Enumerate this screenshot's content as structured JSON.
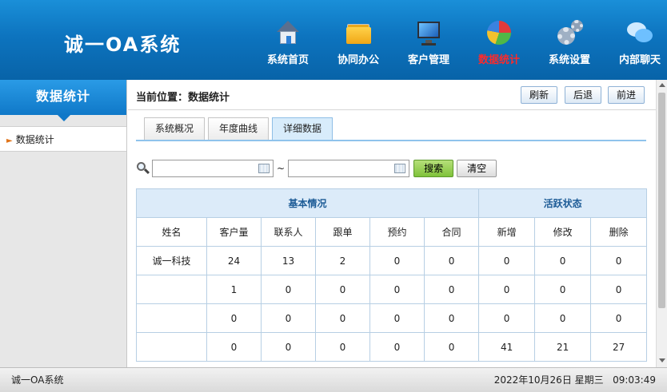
{
  "app": {
    "title": "诚一OA系统"
  },
  "nav": [
    {
      "label": "系统首页",
      "icon": "home-icon"
    },
    {
      "label": "协同办公",
      "icon": "folder-icon"
    },
    {
      "label": "客户管理",
      "icon": "monitor-icon"
    },
    {
      "label": "数据统计",
      "icon": "pie-chart-icon",
      "active": true
    },
    {
      "label": "系统设置",
      "icon": "gear-icon"
    },
    {
      "label": "内部聊天",
      "icon": "chat-icon"
    }
  ],
  "sidebar": {
    "title": "数据统计",
    "items": [
      {
        "label": "数据统计"
      }
    ]
  },
  "breadcrumb": {
    "prefix": "当前位置：",
    "current": "数据统计"
  },
  "toolbar": {
    "refresh": "刷新",
    "back": "后退",
    "forward": "前进"
  },
  "tabs": [
    {
      "label": "系统概况"
    },
    {
      "label": "年度曲线"
    },
    {
      "label": "详细数据",
      "active": true
    }
  ],
  "search": {
    "start": "",
    "end": "",
    "separator": "~",
    "search_label": "搜索",
    "clear_label": "清空"
  },
  "table": {
    "groups": {
      "basic": "基本情况",
      "activity": "活跃状态"
    },
    "columns": [
      "姓名",
      "客户量",
      "联系人",
      "跟单",
      "预约",
      "合同",
      "新增",
      "修改",
      "删除"
    ],
    "rows": [
      [
        "诚一科技",
        "24",
        "13",
        "2",
        "0",
        "0",
        "0",
        "0",
        "0"
      ],
      [
        "",
        "1",
        "0",
        "0",
        "0",
        "0",
        "0",
        "0",
        "0"
      ],
      [
        "",
        "0",
        "0",
        "0",
        "0",
        "0",
        "0",
        "0",
        "0"
      ],
      [
        "",
        "0",
        "0",
        "0",
        "0",
        "0",
        "41",
        "21",
        "27"
      ]
    ]
  },
  "footer": {
    "left": "诚一OA系统",
    "date": "2022年10月26日 星期三",
    "time": "09:03:49"
  }
}
